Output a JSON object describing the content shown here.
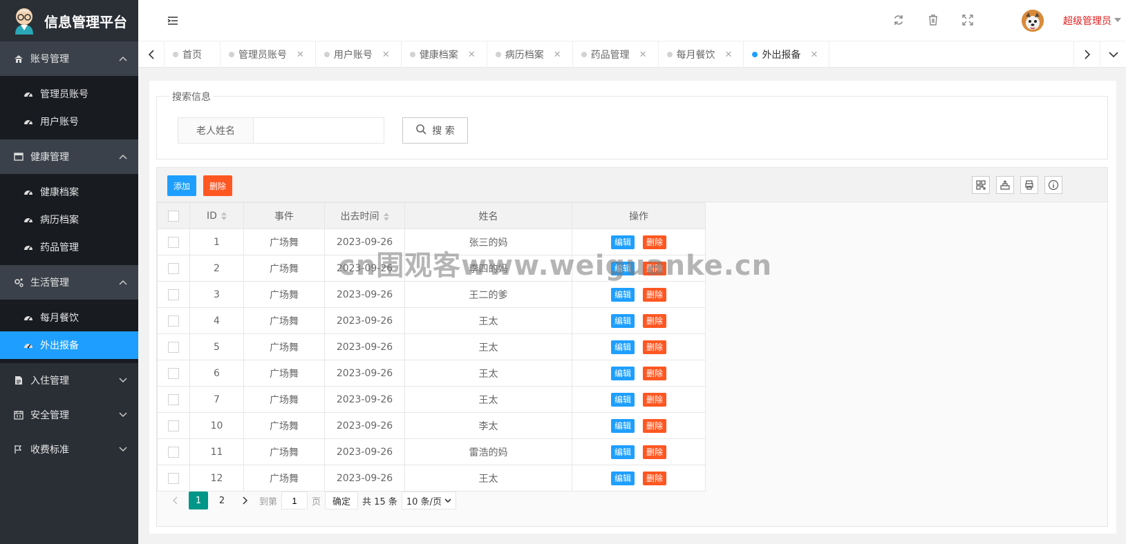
{
  "app": {
    "title": "信息管理平台"
  },
  "sidebar": {
    "groups": [
      {
        "label": "账号管理",
        "icon": "home-icon",
        "open": true,
        "items": [
          {
            "label": "管理员账号"
          },
          {
            "label": "用户账号"
          }
        ]
      },
      {
        "label": "健康管理",
        "icon": "window-icon",
        "open": true,
        "items": [
          {
            "label": "健康档案"
          },
          {
            "label": "病历档案"
          },
          {
            "label": "药品管理"
          }
        ]
      },
      {
        "label": "生活管理",
        "icon": "gears-icon",
        "open": true,
        "items": [
          {
            "label": "每月餐饮"
          },
          {
            "label": "外出报备",
            "active": true
          }
        ]
      },
      {
        "label": "入住管理",
        "icon": "file-icon",
        "open": false,
        "items": []
      },
      {
        "label": "安全管理",
        "icon": "calendar-icon",
        "open": false,
        "items": []
      },
      {
        "label": "收费标准",
        "icon": "flag-icon",
        "open": false,
        "items": []
      }
    ]
  },
  "header": {
    "user": "超级管理员"
  },
  "tabs": [
    {
      "label": "首页",
      "closable": false
    },
    {
      "label": "管理员账号",
      "closable": true
    },
    {
      "label": "用户账号",
      "closable": true
    },
    {
      "label": "健康档案",
      "closable": true
    },
    {
      "label": "病历档案",
      "closable": true
    },
    {
      "label": "药品管理",
      "closable": true
    },
    {
      "label": "每月餐饮",
      "closable": true
    },
    {
      "label": "外出报备",
      "closable": true,
      "active": true
    }
  ],
  "search": {
    "legend": "搜索信息",
    "field_label": "老人姓名",
    "input_value": "",
    "button_label": "搜 索"
  },
  "toolbar": {
    "add_label": "添加",
    "delete_label": "删除"
  },
  "table": {
    "columns": [
      "ID",
      "事件",
      "出去时间",
      "姓名",
      "操作"
    ],
    "edit_label": "编辑",
    "delete_label": "删除",
    "rows": [
      {
        "id": "1",
        "event": "广场舞",
        "time": "2023-09-26",
        "name": "张三的妈"
      },
      {
        "id": "2",
        "event": "广场舞",
        "time": "2023-09-26",
        "name": "李四的妈"
      },
      {
        "id": "3",
        "event": "广场舞",
        "time": "2023-09-26",
        "name": "王二的爹"
      },
      {
        "id": "4",
        "event": "广场舞",
        "time": "2023-09-26",
        "name": "王太"
      },
      {
        "id": "5",
        "event": "广场舞",
        "time": "2023-09-26",
        "name": "王太"
      },
      {
        "id": "6",
        "event": "广场舞",
        "time": "2023-09-26",
        "name": "王太"
      },
      {
        "id": "7",
        "event": "广场舞",
        "time": "2023-09-26",
        "name": "王太"
      },
      {
        "id": "10",
        "event": "广场舞",
        "time": "2023-09-26",
        "name": "李太"
      },
      {
        "id": "11",
        "event": "广场舞",
        "time": "2023-09-26",
        "name": "雷浩的妈"
      },
      {
        "id": "12",
        "event": "广场舞",
        "time": "2023-09-26",
        "name": "王太"
      }
    ]
  },
  "pager": {
    "pages": [
      "1",
      "2"
    ],
    "current": "1",
    "goto_label": "到第",
    "goto_value": "1",
    "page_unit": "页",
    "ok_label": "确定",
    "total": "共 15 条",
    "per_page": "10 条/页"
  },
  "watermark": "cn围观客www.weiguanke.cn",
  "colors": {
    "sidebar_bg": "#2a2f36",
    "active_blue": "#1e9fff",
    "danger": "#ff5722",
    "pager_green": "#009688",
    "user_red": "#e02020"
  }
}
